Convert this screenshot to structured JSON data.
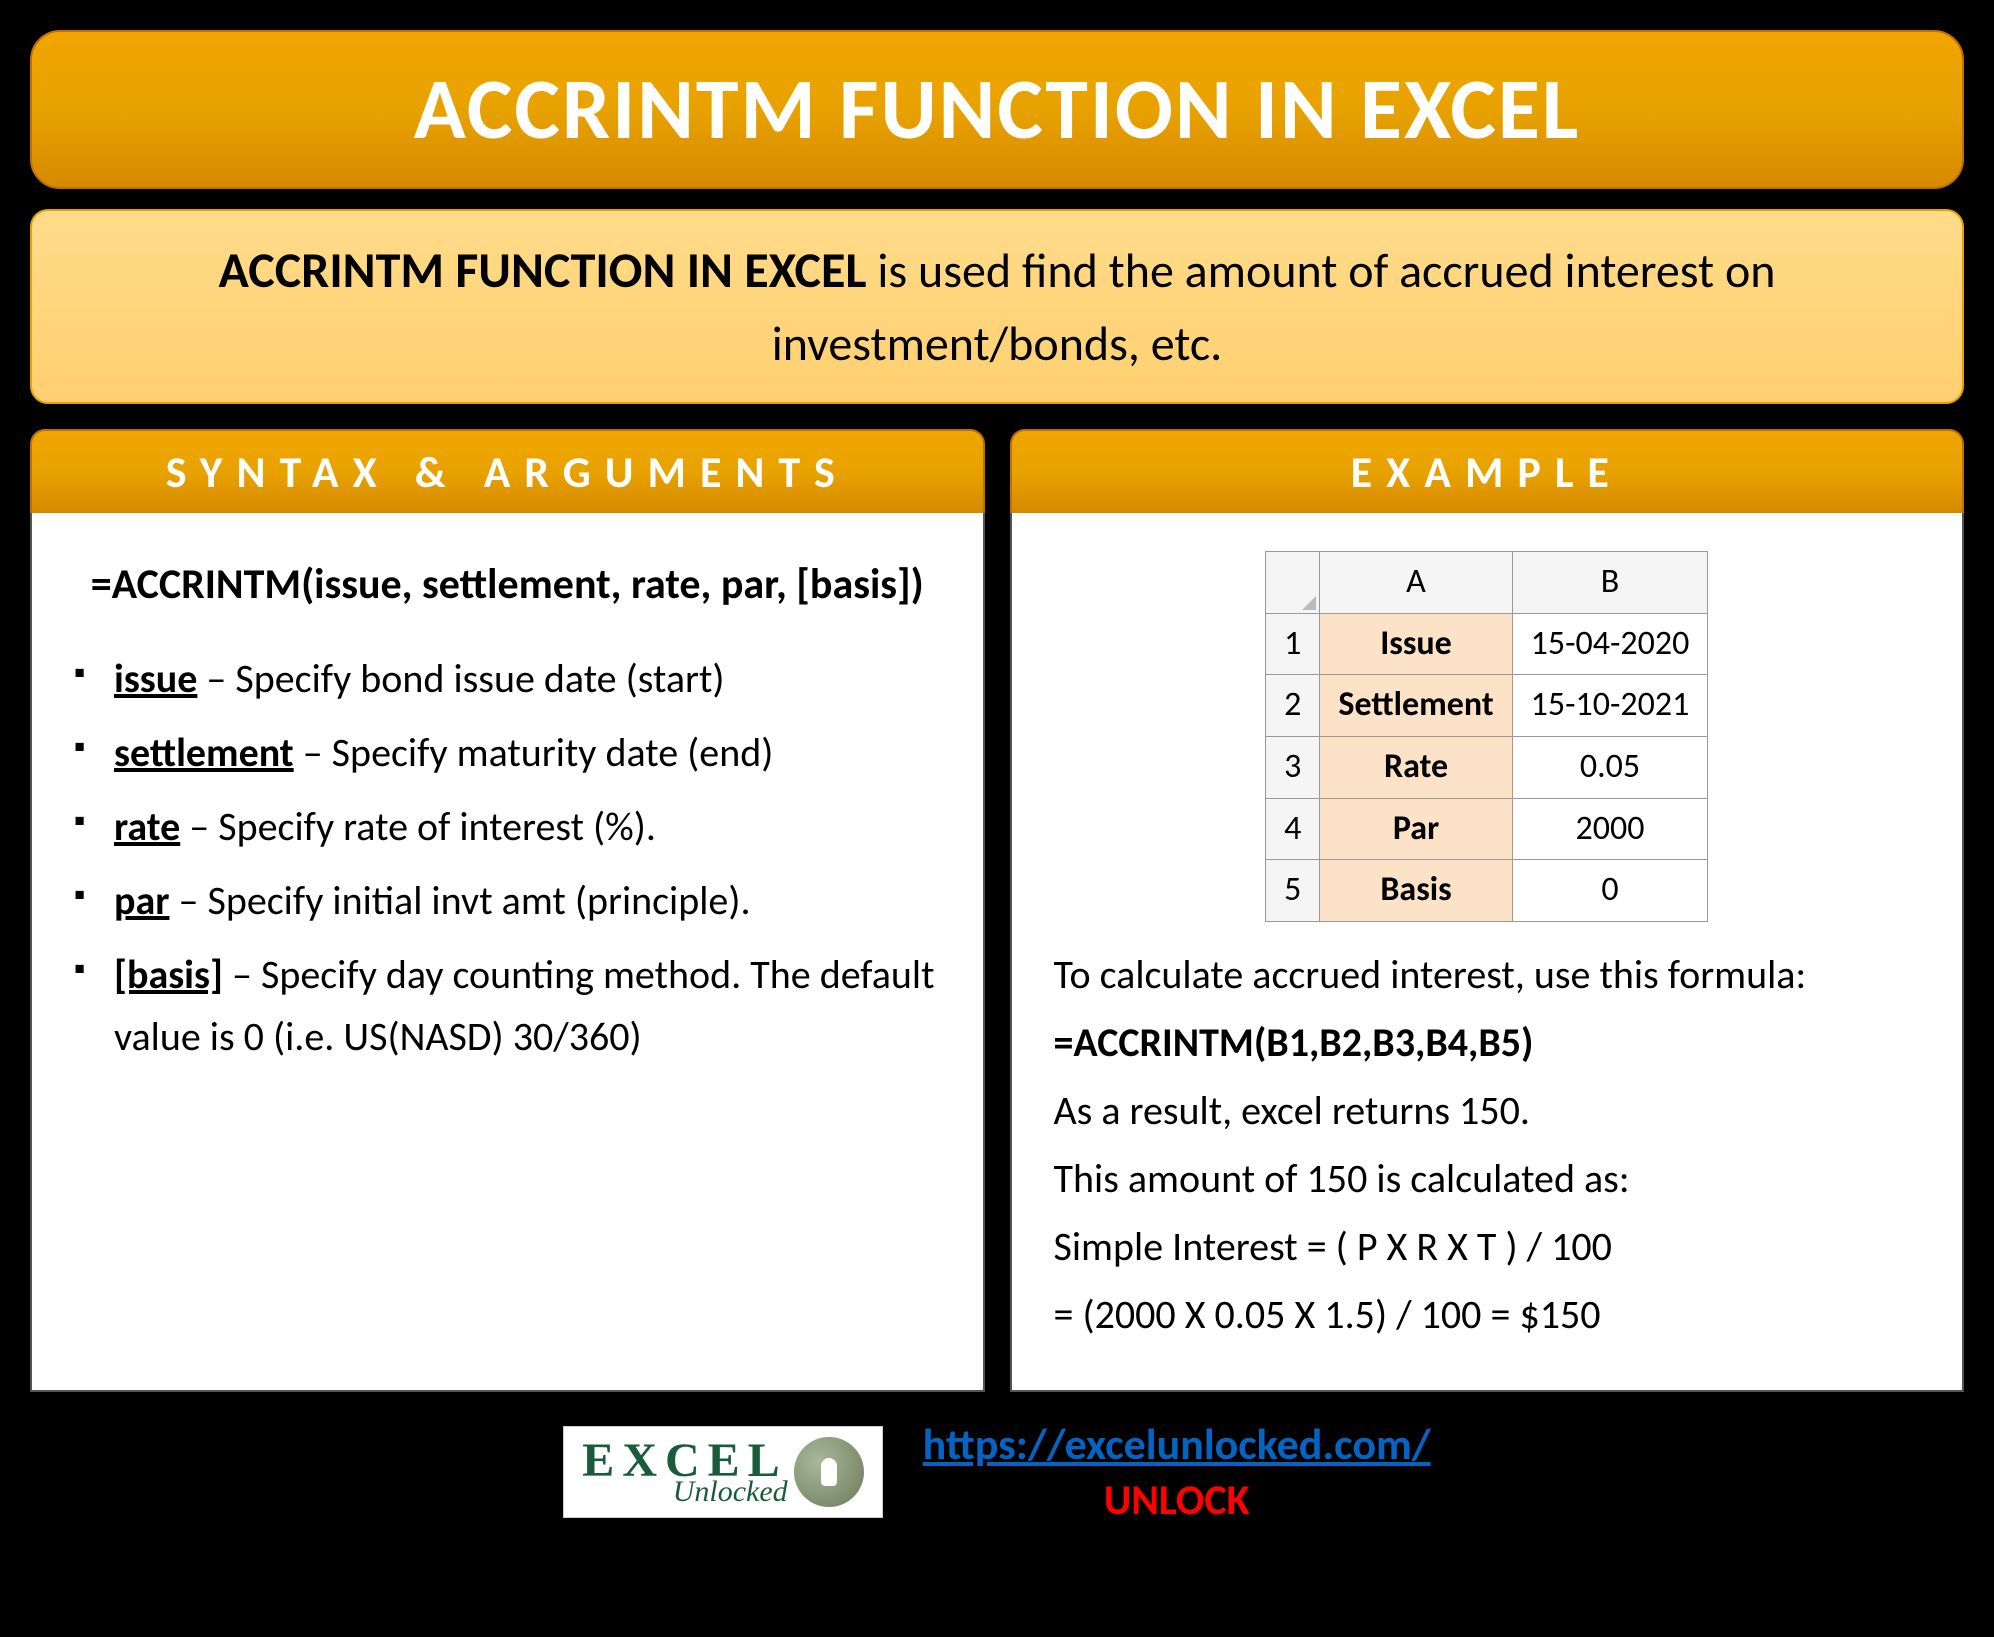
{
  "title": "ACCRINTM FUNCTION IN EXCEL",
  "description": {
    "bold": "ACCRINTM FUNCTION IN EXCEL",
    "rest": " is used find the amount of accrued interest on investment/bonds, etc."
  },
  "syntax": {
    "header": "SYNTAX & ARGUMENTS",
    "formula": "=ACCRINTM(issue, settlement, rate, par, [basis])",
    "args": [
      {
        "name": "issue",
        "desc": " – Specify bond issue date (start)"
      },
      {
        "name": "settlement",
        "desc": " – Specify maturity date (end)"
      },
      {
        "name": "rate",
        "desc": " – Specify rate of interest (%)."
      },
      {
        "name": "par",
        "desc": " – Specify initial invt amt (principle)."
      },
      {
        "name": "[basis]",
        "desc": " – Specify day counting method. The default value is 0 (i.e. US(NASD) 30/360)"
      }
    ]
  },
  "example": {
    "header": "EXAMPLE",
    "cols": [
      "A",
      "B"
    ],
    "rows": [
      {
        "n": "1",
        "label": "Issue",
        "value": "15-04-2020"
      },
      {
        "n": "2",
        "label": "Settlement",
        "value": "15-10-2021"
      },
      {
        "n": "3",
        "label": "Rate",
        "value": "0.05"
      },
      {
        "n": "4",
        "label": "Par",
        "value": "2000"
      },
      {
        "n": "5",
        "label": "Basis",
        "value": "0"
      }
    ],
    "text": {
      "intro": "To calculate accrued interest, use this formula:",
      "formula": "=ACCRINTM(B1,B2,B3,B4,B5)",
      "result": "As a result, excel returns 150.",
      "calc1": "This amount of 150 is calculated as:",
      "calc2": "Simple Interest = ( P X R X T ) / 100",
      "calc3": "= (2000 X 0.05 X 1.5) / 100 = $150"
    }
  },
  "footer": {
    "logo_excel": "EXCEL",
    "logo_unlocked": "Unlocked",
    "url": "https://excelunlocked.com/",
    "unlock": "UNLOCK"
  }
}
